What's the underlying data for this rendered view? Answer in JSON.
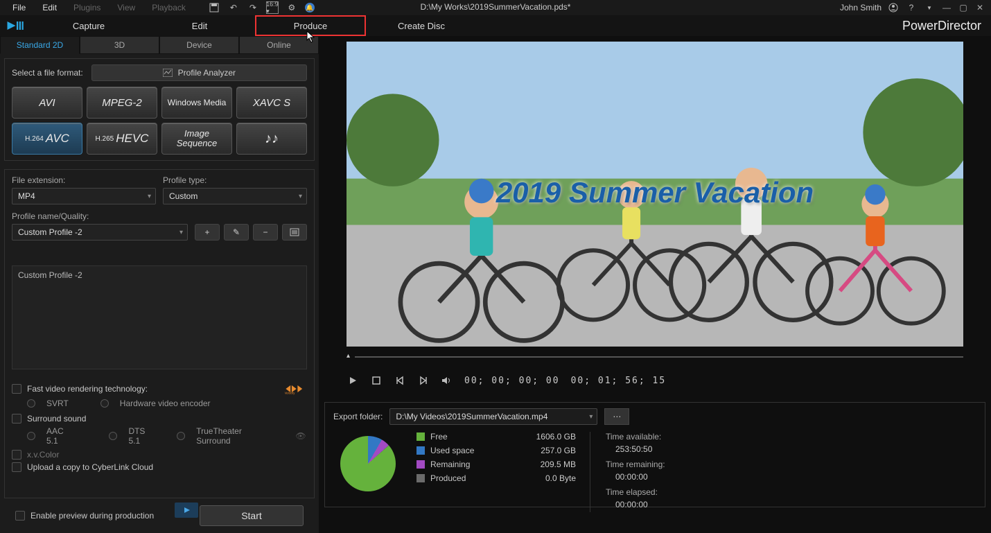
{
  "menubar": {
    "items": [
      "File",
      "Edit",
      "Plugins",
      "View",
      "Playback"
    ],
    "disabled": [
      2,
      3,
      4
    ]
  },
  "title_path": "D:\\My Works\\2019SummerVacation.pds*",
  "user": "John Smith",
  "brand": "PowerDirector",
  "modules": [
    "Capture",
    "Edit",
    "Produce",
    "Create Disc"
  ],
  "module_active": 2,
  "subtabs": [
    "Standard 2D",
    "3D",
    "Device",
    "Online"
  ],
  "subtab_active": 0,
  "select_format_label": "Select a file format:",
  "profile_analyzer": "Profile Analyzer",
  "formats": [
    "AVI",
    "MPEG-2",
    "Windows Media",
    "XAVC S",
    "H.264 AVC",
    "H.265 HEVC",
    "Image Sequence",
    "♪♪"
  ],
  "format_selected": 4,
  "file_ext_label": "File extension:",
  "file_ext_value": "MP4",
  "profile_type_label": "Profile type:",
  "profile_type_value": "Custom",
  "profile_name_label": "Profile name/Quality:",
  "profile_name_value": "Custom Profile -2",
  "profile_desc": "Custom Profile -2",
  "opts": {
    "fast_render": "Fast video rendering technology:",
    "svrt": "SVRT",
    "hw": "Hardware video encoder",
    "surround": "Surround sound",
    "aac": "AAC 5.1",
    "dts": "DTS 5.1",
    "tt": "TrueTheater Surround",
    "xv": "x.v.Color",
    "upload": "Upload a copy to CyberLink Cloud",
    "enable_preview": "Enable preview during production"
  },
  "start": "Start",
  "preview_title": "2019 Summer Vacation",
  "tc_current": "00; 00; 00; 00",
  "tc_total": "00; 01; 56; 15",
  "export": {
    "label": "Export folder:",
    "path": "D:\\My Videos\\2019SummerVacation.mp4",
    "legend": [
      {
        "label": "Free",
        "value": "1606.0  GB",
        "color": "#65b23c"
      },
      {
        "label": "Used space",
        "value": "257.0  GB",
        "color": "#3278c4"
      },
      {
        "label": "Remaining",
        "value": "209.5  MB",
        "color": "#a24ac2"
      },
      {
        "label": "Produced",
        "value": "0.0  Byte",
        "color": "#6b6b6b"
      }
    ],
    "times": [
      {
        "label": "Time available:",
        "value": "253:50:50"
      },
      {
        "label": "Time remaining:",
        "value": "00:00:00"
      },
      {
        "label": "Time elapsed:",
        "value": "00:00:00"
      }
    ]
  },
  "chart_data": {
    "type": "pie",
    "title": "Disk usage",
    "series": [
      {
        "name": "Free",
        "value": 1606.0,
        "unit": "GB",
        "color": "#65b23c"
      },
      {
        "name": "Used space",
        "value": 257.0,
        "unit": "GB",
        "color": "#3278c4"
      },
      {
        "name": "Remaining",
        "value": 209.5,
        "unit": "MB",
        "color": "#a24ac2"
      },
      {
        "name": "Produced",
        "value": 0.0,
        "unit": "Byte",
        "color": "#6b6b6b"
      }
    ]
  }
}
